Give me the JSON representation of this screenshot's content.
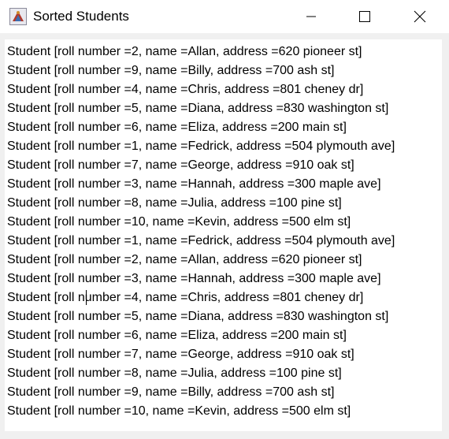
{
  "window": {
    "title": "Sorted Students",
    "icon": "java-icon",
    "controls": [
      "minimize-icon",
      "maximize-icon",
      "close-icon"
    ]
  },
  "text_area": {
    "lines": [
      "Student [roll number =2, name =Allan, address =620 pioneer st]",
      "Student [roll number =9, name =Billy, address =700 ash st]",
      "Student [roll number =4, name =Chris, address =801 cheney dr]",
      "Student [roll number =5, name =Diana, address =830 washington st]",
      "Student [roll number =6, name =Eliza, address =200 main st]",
      "Student [roll number =1, name =Fedrick, address =504 plymouth ave]",
      "Student [roll number =7, name =George, address =910 oak st]",
      "Student [roll number =3, name =Hannah, address =300 maple ave]",
      "Student [roll number =8, name =Julia, address =100 pine st]",
      "Student [roll number =10, name =Kevin, address =500 elm st]",
      "Student [roll number =1, name =Fedrick, address =504 plymouth ave]",
      "Student [roll number =2, name =Allan, address =620 pioneer st]",
      "Student [roll number =3, name =Hannah, address =300 maple ave]",
      "Student [roll number =4, name =Chris, address =801 cheney dr]",
      "Student [roll number =5, name =Diana, address =830 washington st]",
      "Student [roll number =6, name =Eliza, address =200 main st]",
      "Student [roll number =7, name =George, address =910 oak st]",
      "Student [roll number =8, name =Julia, address =100 pine st]",
      "Student [roll number =9, name =Billy, address =700 ash st]",
      "Student [roll number =10, name =Kevin, address =500 elm st]"
    ]
  }
}
